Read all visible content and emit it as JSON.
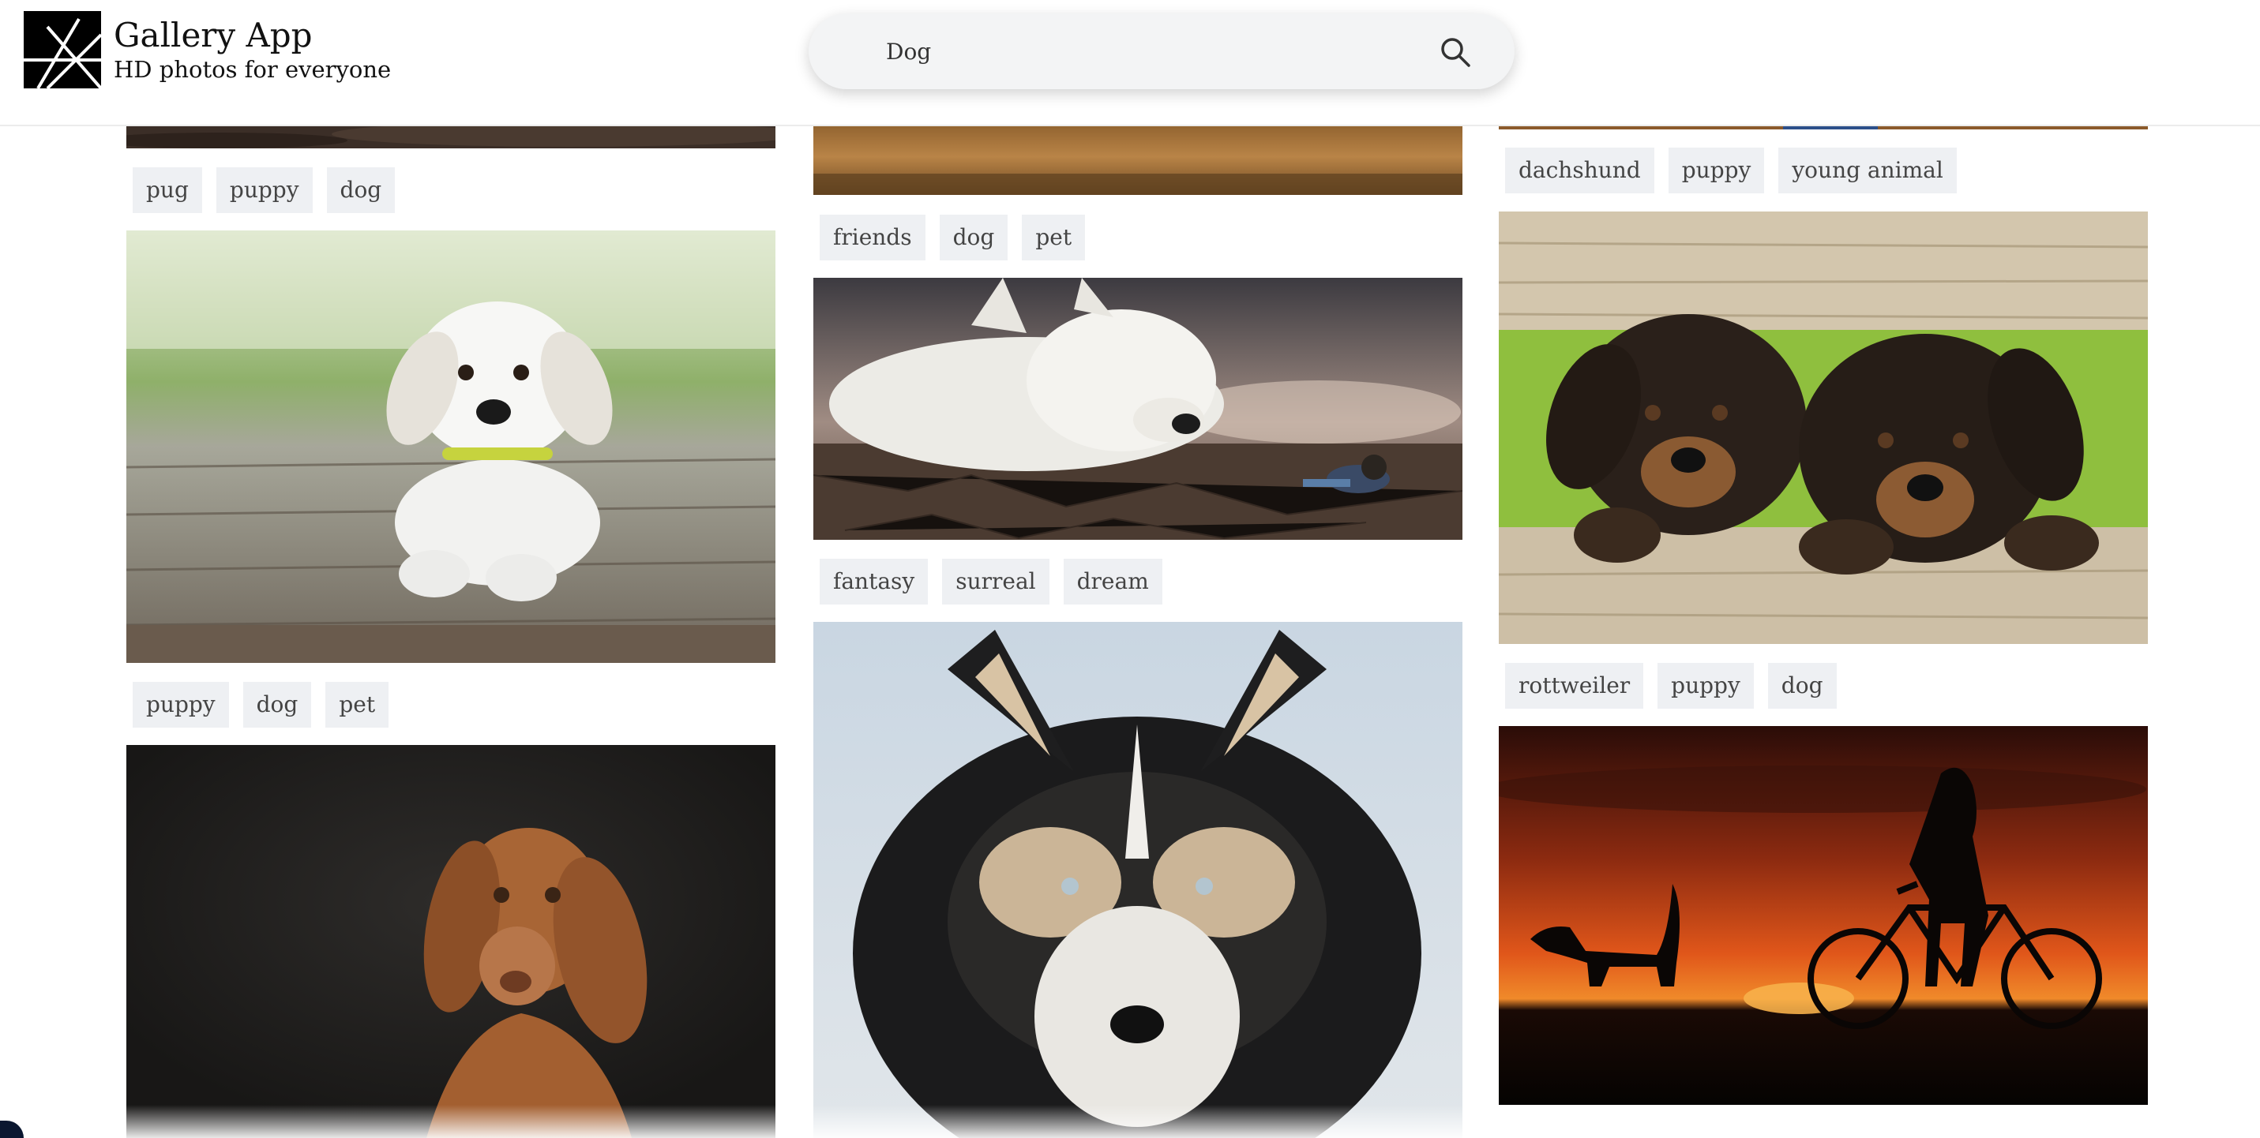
{
  "app": {
    "title": "Gallery App",
    "subtitle": "HD photos for everyone"
  },
  "search": {
    "value": "Dog",
    "icon": "search-icon"
  },
  "columns": [
    {
      "items": [
        {
          "tags": [
            "pug",
            "puppy",
            "dog"
          ]
        },
        {
          "image": "white-puppy-on-wooden-deck",
          "tags": [
            "puppy",
            "dog",
            "pet"
          ]
        },
        {
          "image": "brown-vizsla-dog-portrait"
        }
      ]
    },
    {
      "items": [
        {
          "tags": [
            "friends",
            "dog",
            "pet"
          ]
        },
        {
          "image": "giant-white-dog-and-boy-on-cracked-earth",
          "tags": [
            "fantasy",
            "surreal",
            "dream"
          ]
        },
        {
          "image": "husky-close-up"
        }
      ]
    },
    {
      "items": [
        {
          "tags": [
            "dachshund",
            "puppy",
            "young animal"
          ]
        },
        {
          "image": "rottweiler-puppies-behind-fence",
          "tags": [
            "rottweiler",
            "puppy",
            "dog"
          ]
        },
        {
          "image": "sunset-silhouette-girl-bike-dog"
        }
      ]
    }
  ],
  "colors": {
    "tag_bg": "#eef0f3",
    "search_bg": "#f3f4f5"
  }
}
